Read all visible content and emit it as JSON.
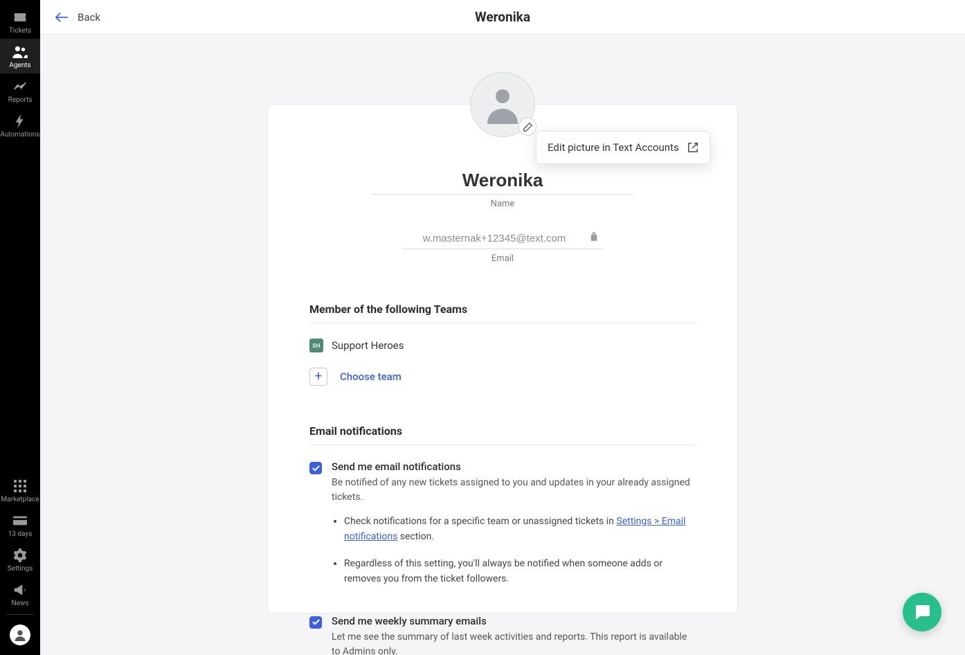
{
  "sidebar": {
    "top": [
      {
        "id": "tickets",
        "label": "Tickets"
      },
      {
        "id": "agents",
        "label": "Agents"
      },
      {
        "id": "reports",
        "label": "Reports"
      },
      {
        "id": "automations",
        "label": "Automations"
      }
    ],
    "bottom": [
      {
        "id": "marketplace",
        "label": "Marketplace"
      },
      {
        "id": "trial",
        "label": "13 days"
      },
      {
        "id": "settings",
        "label": "Settings"
      },
      {
        "id": "news",
        "label": "News"
      }
    ],
    "active": "agents"
  },
  "header": {
    "back": "Back",
    "title": "Weronika"
  },
  "popover": {
    "text": "Edit picture in Text Accounts"
  },
  "profile": {
    "name": "Weronika",
    "name_label": "Name",
    "email": "w.masternak+12345@text.com",
    "email_label": "Email"
  },
  "teams": {
    "heading": "Member of the following Teams",
    "items": [
      {
        "badge": "SH",
        "name": "Support Heroes"
      }
    ],
    "choose": "Choose team"
  },
  "notifications": {
    "heading": "Email notifications",
    "items": [
      {
        "checked": true,
        "title": "Send me email notifications",
        "desc": "Be notified of any new tickets assigned to you and updates in your already assigned tickets.",
        "bullets": [
          {
            "pre": "Check notifications for a specific team or unassigned tickets in ",
            "link": "Settings > Email notifications",
            "post": " section."
          },
          {
            "pre": "Regardless of this setting, you'll always be notified when someone adds or removes you from the ticket followers.",
            "link": "",
            "post": ""
          }
        ]
      },
      {
        "checked": true,
        "title": "Send me weekly summary emails",
        "desc": "Let me see the summary of last week activities and reports. This report is available to Admins only."
      }
    ]
  }
}
